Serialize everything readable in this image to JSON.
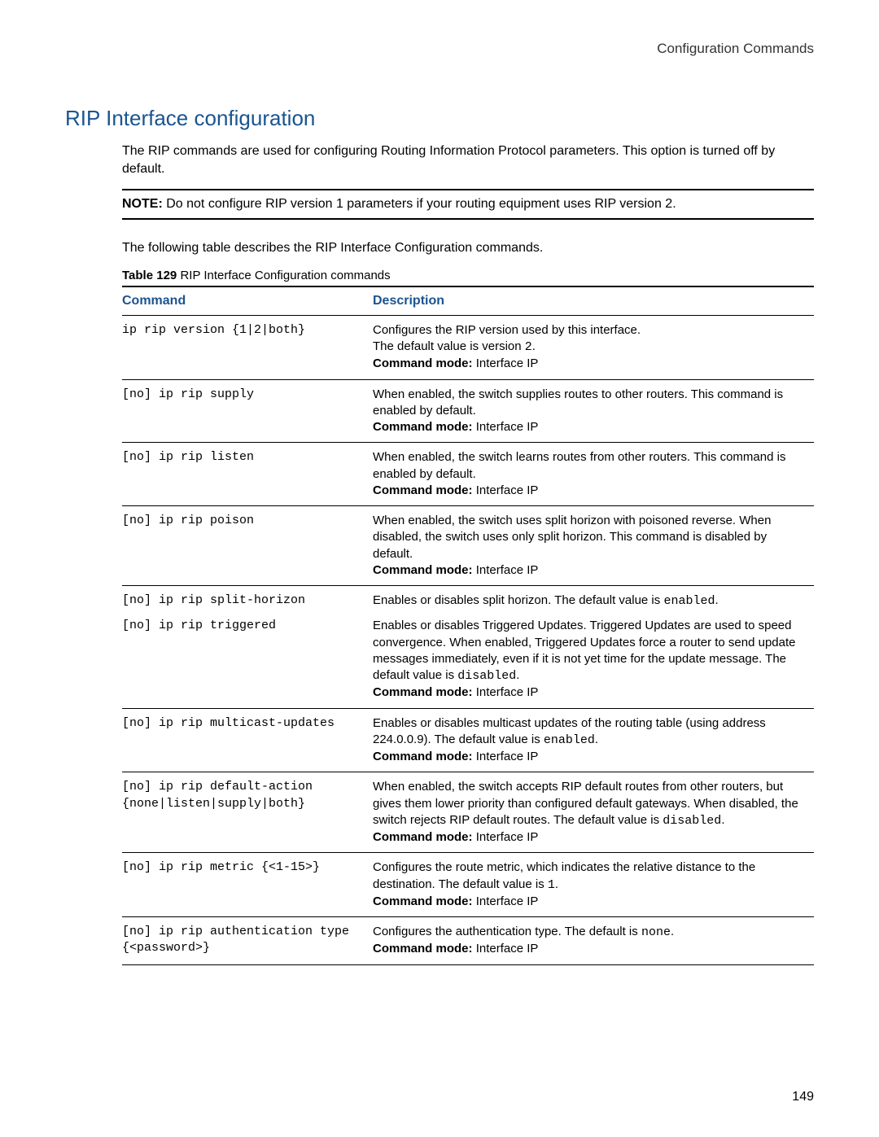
{
  "header": "Configuration Commands",
  "section_title": "RIP Interface configuration",
  "intro": "The RIP commands are used for configuring Routing Information Protocol parameters. This option is turned off by default.",
  "note_label": "NOTE:",
  "note_text": "Do not configure RIP version 1 parameters if your routing equipment uses RIP version 2.",
  "table_intro": "The following table describes the RIP Interface Configuration commands.",
  "table_caption_label": "Table 129",
  "table_caption_text": "RIP Interface Configuration commands",
  "columns": {
    "cmd": "Command",
    "desc": "Description"
  },
  "mode_label": "Command mode:",
  "mode_value": "Interface IP",
  "rows": {
    "r1": {
      "cmd": "ip rip version {1|2|both}",
      "line1": "Configures the RIP version used by this interface.",
      "line2a": "The default value is version ",
      "line2b": "2",
      "line2c": "."
    },
    "r2": {
      "cmd": "[no] ip rip supply",
      "line1": "When enabled, the switch supplies routes to other routers. This command is enabled by default."
    },
    "r3": {
      "cmd": "[no] ip rip listen",
      "line1": "When enabled, the switch learns routes from other routers. This command is enabled by default."
    },
    "r4": {
      "cmd": "[no] ip rip poison",
      "line1": "When enabled, the switch uses split horizon with poisoned reverse. When disabled, the switch uses only split horizon. This command is disabled by default."
    },
    "r5": {
      "cmd": "[no] ip rip split-horizon",
      "line1a": "Enables or disables split horizon. The default value is ",
      "line1b": "enabled",
      "line1c": "."
    },
    "r6": {
      "cmd": "[no] ip rip triggered",
      "line1a": "Enables or disables Triggered Updates. Triggered Updates are used to speed convergence. When enabled, Triggered Updates force a router to send update messages immediately, even if it is not yet time for the update message. The default value is ",
      "line1b": "disabled",
      "line1c": "."
    },
    "r7": {
      "cmd": "[no] ip rip multicast-updates",
      "line1a": "Enables or disables multicast updates of the routing table (using address 224.0.0.9). The default value is ",
      "line1b": "enabled",
      "line1c": "."
    },
    "r8": {
      "cmd": "[no] ip rip default-action {none|listen|supply|both}",
      "line1a": "When enabled, the switch accepts RIP default routes from other routers, but gives them lower priority than configured default gateways. When disabled, the switch rejects RIP default routes. The default value is ",
      "line1b": "disabled",
      "line1c": "."
    },
    "r9": {
      "cmd": "[no] ip rip metric {<1-15>}",
      "line1a": "Configures the route metric, which indicates the relative distance to the destination. The default value is ",
      "line1b": "1",
      "line1c": "."
    },
    "r10": {
      "cmd": "[no] ip rip authentication type {<password>}",
      "line1a": "Configures the authentication type. The default is ",
      "line1b": "none",
      "line1c": "."
    }
  },
  "page_number": "149"
}
